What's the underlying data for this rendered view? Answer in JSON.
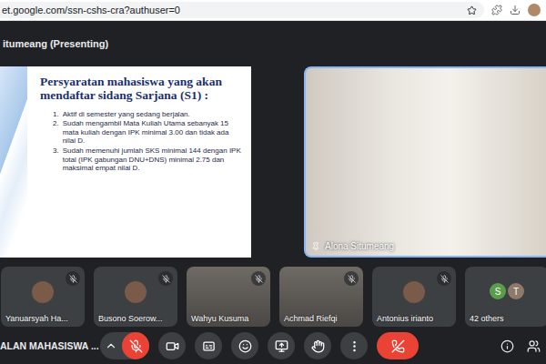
{
  "browser": {
    "url": "et.google.com/ssn-cshs-cra?authuser=0"
  },
  "presenter_label": "itumeang (Presenting)",
  "slide": {
    "title": "Persyaratan mahasiswa yang akan mendaftar sidang Sarjana (S1) :",
    "items": [
      {
        "number": "1.",
        "text": "Aktif di semester yang sedang berjalan."
      },
      {
        "number": "2.",
        "text": "Sudah mengambil Mata Kuliah Utama sebanyak 15 mata kuliah dengan IPK minimal 3.00 dan tidak ada nilai D."
      },
      {
        "number": "3.",
        "text": "Sudah memenuhi jumlah SKS minimal 144 dengan IPK total (IPK gabungan DNU+DNS) minimal 2.75 dan maksimal empat nilai D."
      }
    ]
  },
  "speaker": {
    "name": "Alona Situmeang",
    "pinned": true
  },
  "participants": [
    {
      "name": "Yanuarsyah Ha...",
      "muted": true,
      "kind": "avatar"
    },
    {
      "name": "Busono Soerow...",
      "muted": true,
      "kind": "avatar"
    },
    {
      "name": "Wahyu Kusuma",
      "muted": true,
      "kind": "video"
    },
    {
      "name": "Achmad Riefqi",
      "muted": true,
      "kind": "video"
    },
    {
      "name": "Antonius irianto",
      "muted": true,
      "kind": "avatar"
    }
  ],
  "others": {
    "label": "42 others",
    "avatars": [
      {
        "initial": "S",
        "color": "#5a9e4b"
      },
      {
        "initial": "T",
        "color": "#8d7a6a"
      }
    ]
  },
  "meeting_title": "ALAN MAHASISWA ...",
  "controls": {
    "mic_muted": true,
    "camera_on": true,
    "captions_on": false,
    "hand_raised": false
  }
}
